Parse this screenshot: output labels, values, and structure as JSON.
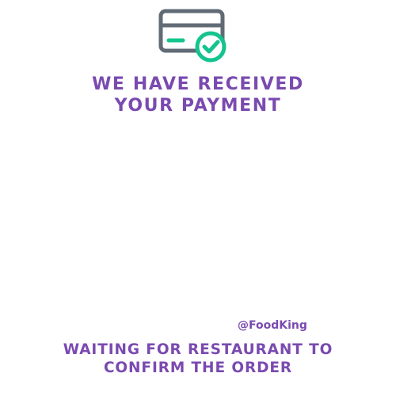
{
  "payment_status": {
    "icon": "credit-card-check-icon",
    "title_line1": "WE HAVE RECEIVED",
    "title_line2": "YOUR PAYMENT"
  },
  "brand": {
    "handle": "@FoodKing"
  },
  "order_status": {
    "line1": "WAITING FOR RESTAURANT TO",
    "line2": "CONFIRM THE ORDER"
  },
  "colors": {
    "accent_purple": "#7a4ab0",
    "card_gray": "#616b75",
    "check_green": "#14c48e",
    "background": "#ffffff"
  }
}
